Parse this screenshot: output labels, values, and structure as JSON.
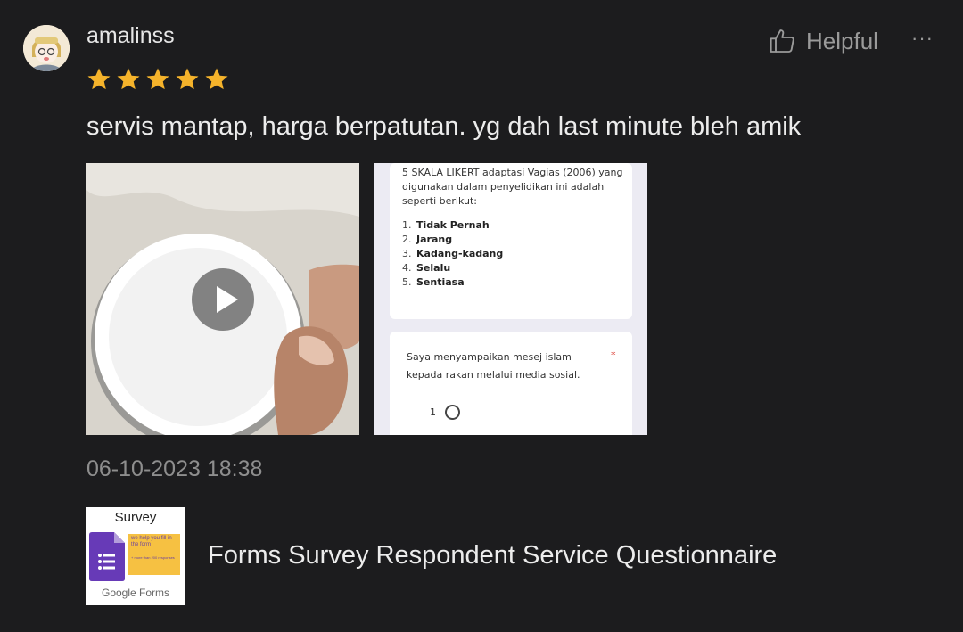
{
  "review": {
    "username": "amalinss",
    "rating": 5,
    "text": "servis mantap, harga berpatutan. yg dah last minute bleh amik",
    "timestamp": "06-10-2023 18:38",
    "helpful_label": "Helpful",
    "more_label": "···"
  },
  "media": {
    "form_intro": "5 SKALA LIKERT adaptasi Vagias (2006) yang digunakan dalam penyelidikan ini adalah seperti berikut:",
    "scale_items": [
      {
        "num": "1.",
        "label": "Tidak Pernah"
      },
      {
        "num": "2.",
        "label": "Jarang"
      },
      {
        "num": "3.",
        "label": "Kadang-kadang"
      },
      {
        "num": "4.",
        "label": "Selalu"
      },
      {
        "num": "5.",
        "label": "Sentiasa"
      }
    ],
    "question": "Saya menyampaikan mesej islam kepada rakan melalui media sosial.",
    "required_mark": "*",
    "option_1": "1"
  },
  "product": {
    "thumb_title": "Survey",
    "thumb_tag_line1": "we help you fill in the form",
    "thumb_tag_line2": "+ more than 200 responses",
    "thumb_brand": "Google Forms",
    "name": "Forms Survey Respondent Service Questionnaire"
  },
  "colors": {
    "background": "#1c1c1e",
    "star": "#f5b32b",
    "secondary_text": "#8e8e8e",
    "forms_purple": "#673ab7"
  },
  "icons": {
    "star": "star-icon",
    "helpful": "thumbs-up-icon",
    "play": "play-icon",
    "more": "more-icon"
  }
}
